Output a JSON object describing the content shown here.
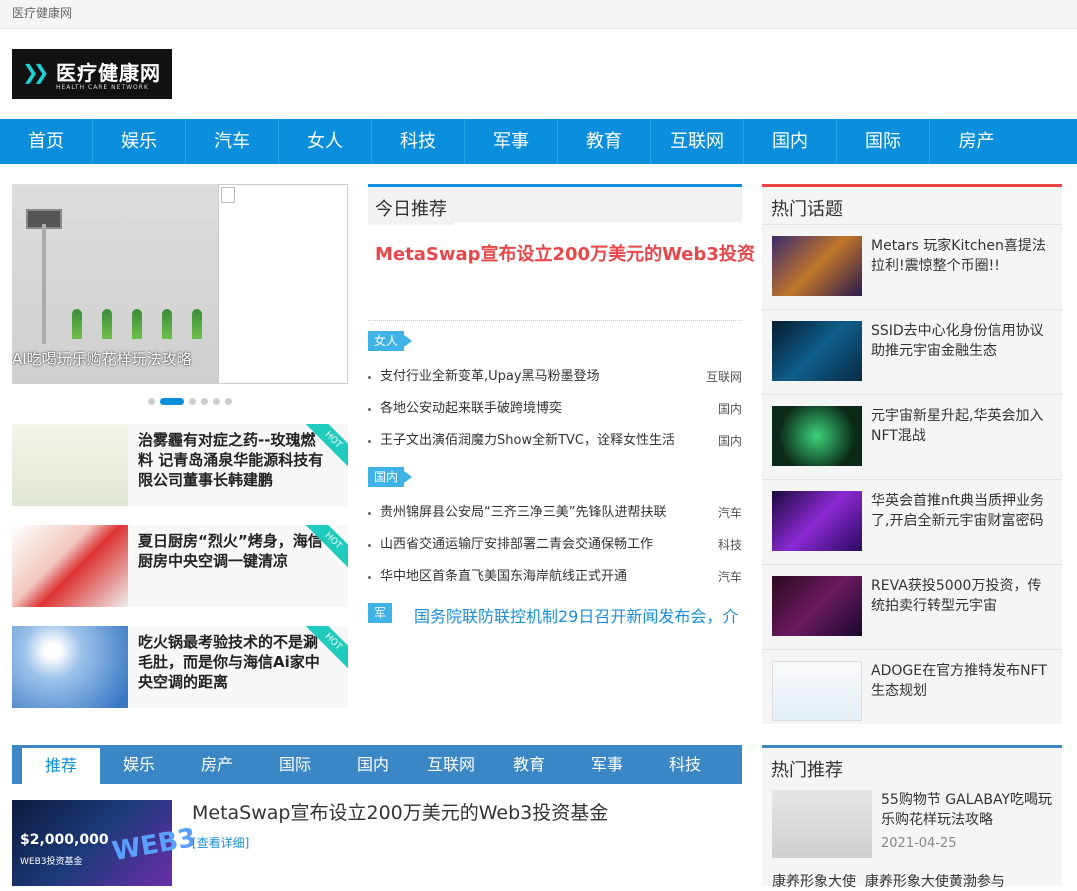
{
  "site": {
    "top_label": "医疗健康网",
    "logo_cn": "医疗健康网",
    "logo_en": "HEALTH CARE NETWORK"
  },
  "nav": [
    "首页",
    "娱乐",
    "汽车",
    "女人",
    "科技",
    "军事",
    "教育",
    "互联网",
    "国内",
    "国际",
    "房产"
  ],
  "slider": {
    "caption": "AI吃喝玩乐购花样玩法攻略"
  },
  "left_news": [
    {
      "title": "治雾霾有对症之药--玫瑰燃料 记青岛涌泉华能源科技有限公司董事长韩建鹏",
      "badge": "HOT"
    },
    {
      "title": "夏日厨房“烈火”烤身，海信厨房中央空调一键清凉",
      "badge": "HOT"
    },
    {
      "title": "吃火锅最考验技术的不是涮毛肚，而是你与海信Ai家中央空调的距离",
      "badge": "HOT"
    }
  ],
  "middle": {
    "tab": "今日推荐",
    "headline": "MetaSwap宣布设立200万美元的Web3投资",
    "group1_tag": "女人",
    "group1": [
      {
        "title": "支付行业全新变革,Upay黑马粉墨登场",
        "cat": "互联网"
      },
      {
        "title": "各地公安动起来联手破跨境博奕",
        "cat": "国内"
      },
      {
        "title": "王子文出演佰润魔力Show全新TVC，诠释女性生活",
        "cat": "国内"
      }
    ],
    "group2_tag": "国内",
    "group2": [
      {
        "title": "贵州锦屏县公安局“三齐三净三美”先锋队进帮扶联",
        "cat": "汽车"
      },
      {
        "title": "山西省交通运输厅安排部署二青会交通保畅工作",
        "cat": "科技"
      },
      {
        "title": "华中地区首条直飞美国东海岸航线正式开通",
        "cat": "汽车"
      }
    ],
    "military_tag": "军事",
    "military_title": "国务院联防联控机制29日召开新闻发布会，介"
  },
  "hot_topics": {
    "title": "热门话题",
    "items": [
      {
        "title": "Metars 玩家Kitchen喜提法拉利!震惊整个币圈!!"
      },
      {
        "title": "SSID去中心化身份信用协议助推元宇宙金融生态"
      },
      {
        "title": "元宇宙新星升起,华英会加入NFT混战"
      },
      {
        "title": "华英会首推nft典当质押业务了,开启全新元宇宙财富密码"
      },
      {
        "title": "REVA获投5000万投资，传统拍卖行转型元宇宙"
      },
      {
        "title": "ADOGE在官方推特发布NFT生态规划"
      }
    ]
  },
  "bottom_tabs": [
    "推荐",
    "娱乐",
    "房产",
    "国际",
    "国内",
    "互联网",
    "教育",
    "军事",
    "科技"
  ],
  "bottom_news": {
    "title": "MetaSwap宣布设立200万美元的Web3投资基金",
    "more": "[查看详细]",
    "img_amount": "$2,000,000",
    "img_sub": "WEB3投资基金",
    "img_word": "WEB3"
  },
  "hot_recommend": {
    "title": "热门推荐",
    "item_title": "55购物节 GALABAY吃喝玩乐购花样玩法攻略",
    "item_date": "2021-04-25",
    "item2_title": "康养形象大使黄渤参与",
    "item2_alt": "康养形象大使"
  },
  "colors": {
    "primary": "#0b8fdc",
    "accent": "#e8474a",
    "teal": "#1ecbbd"
  }
}
